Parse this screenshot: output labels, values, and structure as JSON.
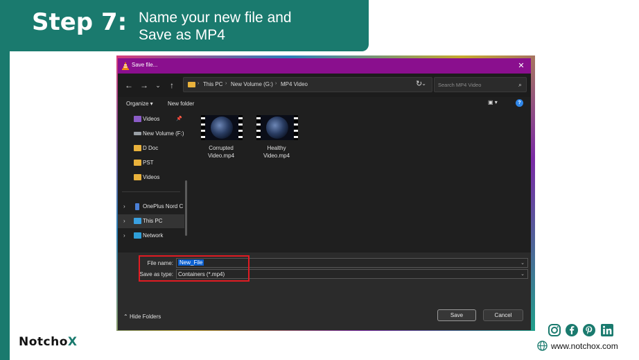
{
  "banner": {
    "step": "Step 7:",
    "description_line1": "Name your new file and",
    "description_line2": "Save as MP4"
  },
  "dialog": {
    "title": "Save file...",
    "close_glyph": "✕",
    "address": {
      "segments": [
        "This PC",
        "New Volume (G:)",
        "MP4 Video"
      ]
    },
    "search_placeholder": "Search MP4 Video",
    "commands": {
      "organize": "Organize ▾",
      "new_folder": "New folder"
    },
    "sidebar": {
      "items": [
        {
          "label": "Videos",
          "icon": "videos-icon",
          "pinned": true
        },
        {
          "label": "New Volume (F:)",
          "icon": "drive-icon"
        },
        {
          "label": "D Doc",
          "icon": "folder-icon"
        },
        {
          "label": "PST",
          "icon": "folder-icon"
        },
        {
          "label": "Videos",
          "icon": "folder-icon"
        },
        {
          "label": "OnePlus Nord C",
          "icon": "phone-icon"
        },
        {
          "label": "This PC",
          "icon": "pc-icon",
          "selected": true
        },
        {
          "label": "Network",
          "icon": "network-icon"
        }
      ]
    },
    "files": [
      {
        "name_line1": "Corrupted",
        "name_line2": "Video.mp4"
      },
      {
        "name_line1": "Healthy",
        "name_line2": "Video.mp4"
      }
    ],
    "form": {
      "file_name_label": "File name:",
      "file_name_value": "New_File",
      "save_type_label": "Save as type:",
      "save_type_value": "Containers (*.mp4)"
    },
    "hide_folders": "Hide Folders",
    "save_label": "Save",
    "cancel_label": "Cancel"
  },
  "footer": {
    "logo_part1": "Notch",
    "logo_part2": "o",
    "logo_part3": "X",
    "website": "www.notchox.com",
    "social_icons": [
      "instagram-icon",
      "facebook-icon",
      "pinterest-icon",
      "linkedin-icon"
    ]
  },
  "colors": {
    "brand_teal": "#1a7a6e",
    "titlebar": "#8a0f8e",
    "highlight": "#e11b22",
    "selection": "#0a5fd0"
  }
}
